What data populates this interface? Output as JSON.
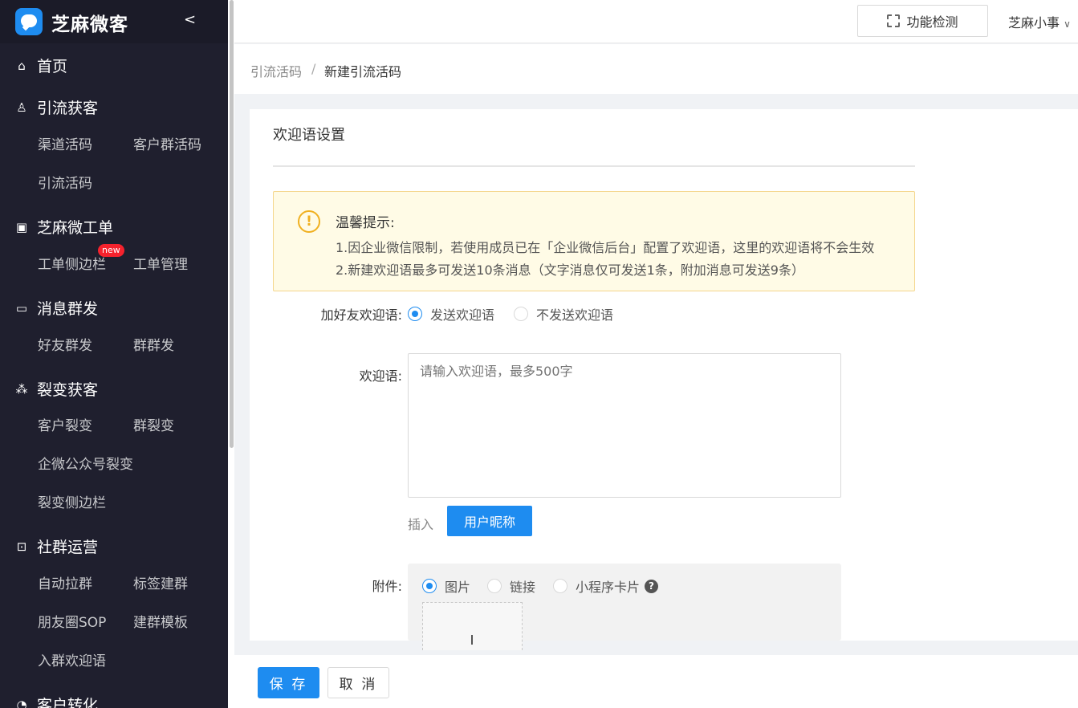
{
  "app": {
    "logo_text": "芝麻微客"
  },
  "sidebar": {
    "groups": [
      {
        "label": "首页",
        "icon": "home-icon"
      },
      {
        "label": "引流获客",
        "icon": "user-growth-icon",
        "items": [
          "渠道活码",
          "客户群活码",
          "引流活码"
        ]
      },
      {
        "label": "芝麻微工单",
        "icon": "clipboard-icon",
        "items": [
          "工单侧边栏",
          "工单管理"
        ],
        "badge": "new"
      },
      {
        "label": "消息群发",
        "icon": "message-icon",
        "items": [
          "好友群发",
          "群群发"
        ]
      },
      {
        "label": "裂变获客",
        "icon": "fission-icon",
        "items": [
          "客户裂变",
          "群裂变",
          "企微公众号裂变",
          "裂变侧边栏"
        ]
      },
      {
        "label": "社群运营",
        "icon": "chart-icon",
        "items": [
          "自动拉群",
          "标签建群",
          "朋友圈SOP",
          "建群模板",
          "入群欢迎语"
        ]
      },
      {
        "label": "客户转化",
        "icon": "convert-icon"
      }
    ]
  },
  "header": {
    "func_check_label": "功能检测",
    "user_name": "芝麻小事"
  },
  "breadcrumb": {
    "parent": "引流活码",
    "separator": "/",
    "current": "新建引流活码"
  },
  "section": {
    "title": "欢迎语设置"
  },
  "alert": {
    "icon": "exclamation-icon",
    "title": "温馨提示:",
    "line1": "1.因企业微信限制，若使用成员已在「企业微信后台」配置了欢迎语，这里的欢迎语将不会生效",
    "line2": "2.新建欢迎语最多可发送10条消息（文字消息仅可发送1条，附加消息可发送9条）"
  },
  "form": {
    "add_friend_label": "加好友欢迎语:",
    "send_option": "发送欢迎语",
    "no_send_option": "不发送欢迎语",
    "welcome_label": "欢迎语:",
    "welcome_placeholder": "请输入欢迎语，最多500字",
    "insert_label": "插入",
    "nickname_button": "用户昵称",
    "attachment_label": "附件:",
    "attach_image": "图片",
    "attach_link": "链接",
    "attach_miniprogram": "小程序卡片"
  },
  "footer": {
    "save_label": "保 存",
    "cancel_label": "取 消"
  }
}
